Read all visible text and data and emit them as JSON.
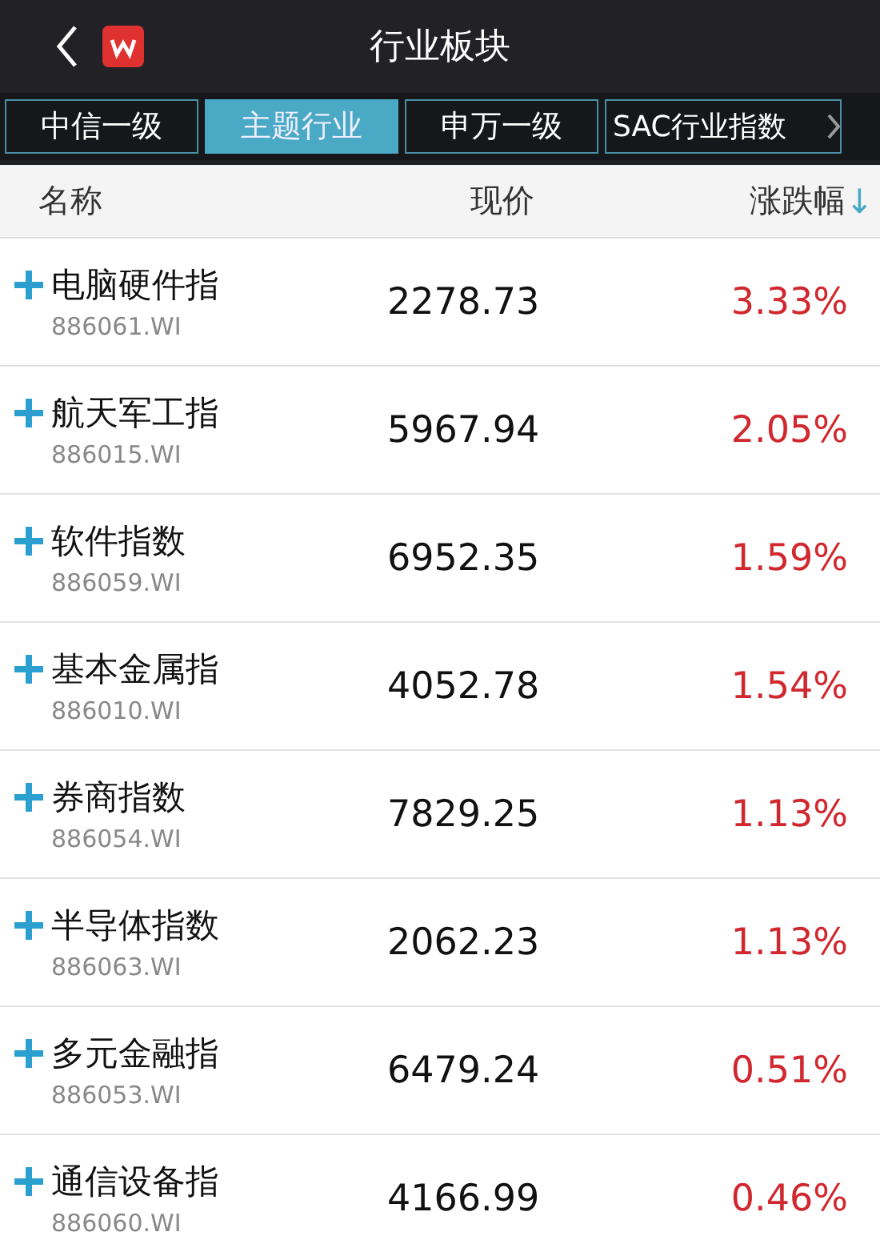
{
  "header": {
    "title": "行业板块"
  },
  "tabs": [
    {
      "label": "中信一级",
      "selected": false
    },
    {
      "label": "主题行业",
      "selected": true
    },
    {
      "label": "申万一级",
      "selected": false
    },
    {
      "label": "SAC行业指数",
      "selected": false
    }
  ],
  "columns": [
    {
      "label": "名称"
    },
    {
      "label": "现价"
    },
    {
      "label": "涨跌幅",
      "sort_mark": "↓"
    }
  ],
  "rows": [
    {
      "name": "电脑硬件指",
      "code": "886061.WI",
      "price": "2278.73",
      "change": "3.33%"
    },
    {
      "name": "航天军工指",
      "code": "886015.WI",
      "price": "5967.94",
      "change": "2.05%"
    },
    {
      "name": "软件指数",
      "code": "886059.WI",
      "price": "6952.35",
      "change": "1.59%"
    },
    {
      "name": "基本金属指",
      "code": "886010.WI",
      "price": "4052.78",
      "change": "1.54%"
    },
    {
      "name": "券商指数",
      "code": "886054.WI",
      "price": "7829.25",
      "change": "1.13%"
    },
    {
      "name": "半导体指数",
      "code": "886063.WI",
      "price": "2062.23",
      "change": "1.13%"
    },
    {
      "name": "多元金融指",
      "code": "886053.WI",
      "price": "6479.24",
      "change": "0.51%"
    },
    {
      "name": "通信设备指",
      "code": "886060.WI",
      "price": "4166.99",
      "change": "0.46%"
    }
  ]
}
